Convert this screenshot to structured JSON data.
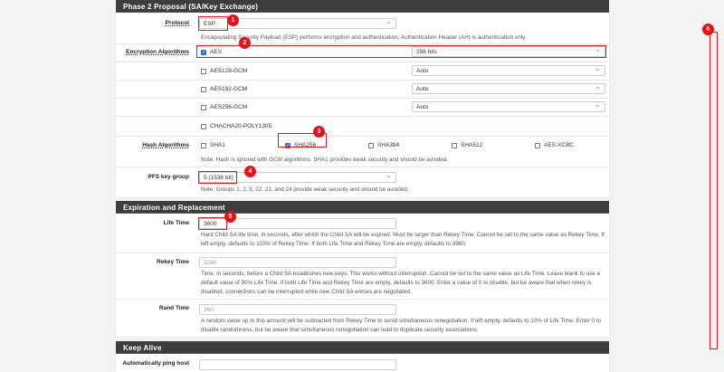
{
  "sections": {
    "phase2": "Phase 2 Proposal (SA/Key Exchange)",
    "expiration": "Expiration and Replacement",
    "keepalive": "Keep Alive"
  },
  "protocol": {
    "label": "Protocol",
    "value": "ESP",
    "note": "Encapsulating Security Payload (ESP) performs encryption and authentication, Authentication Header (AH) is authentication only."
  },
  "encryption": {
    "label": "Encryption Algorithms",
    "items": [
      {
        "name": "AES",
        "checked": true,
        "keylen": "256 bits"
      },
      {
        "name": "AES128-GCM",
        "checked": false,
        "keylen": "Auto"
      },
      {
        "name": "AES192-GCM",
        "checked": false,
        "keylen": "Auto"
      },
      {
        "name": "AES256-GCM",
        "checked": false,
        "keylen": "Auto"
      },
      {
        "name": "CHACHA20-POLY1305",
        "checked": false
      }
    ]
  },
  "hash": {
    "label": "Hash Algorithms",
    "items": [
      {
        "name": "SHA1",
        "checked": false
      },
      {
        "name": "SHA256",
        "checked": true
      },
      {
        "name": "SHA384",
        "checked": false
      },
      {
        "name": "SHA512",
        "checked": false
      },
      {
        "name": "AES-XCBC",
        "checked": false
      }
    ],
    "note": "Note: Hash is ignored with GCM algorithms. SHA1 provides weak security and should be avoided."
  },
  "pfs": {
    "label": "PFS key group",
    "value": "5 (1536 bit)",
    "note": "Note: Groups 1, 2, 5, 22, 23, and 24 provide weak security and should be avoided."
  },
  "lifetime": {
    "label": "Life Time",
    "value": "3600",
    "note": "Hard Child SA life time, in seconds, after which the Child SA will be expired. Must be larger than Rekey Time. Cannot be set to the same value as Rekey Time. If left empty, defaults to 110% of Rekey Time. If both Life Time and Rekey Time are empty, defaults to 3960."
  },
  "rekey": {
    "label": "Rekey Time",
    "placeholder": "3240",
    "note": "Time, in seconds, before a Child SA establishes new keys. This works without interruption. Cannot be set to the same value as Life Time. Leave blank to use a default value of 90% Life Time. If both Life Time and Rekey Time are empty, defaults to 3600. Enter a value of 0 to disable, but be aware that when rekey is disabled, connections can be interrupted while new Child SA entries are negotiated."
  },
  "rand": {
    "label": "Rand Time",
    "placeholder": "360",
    "note": "A random value up to this amount will be subtracted from Rekey Time to avoid simultaneous renegotiation. If left empty, defaults to 10% of Life Time. Enter 0 to disable randomness, but be aware that simultaneous renegotiation can lead to duplicate security associations."
  },
  "ping": {
    "label": "Automatically ping host"
  },
  "annotations": [
    "1",
    "2",
    "3",
    "4",
    "5",
    "6"
  ],
  "colors": {
    "annotation": "#e0141b",
    "header": "#3d3d3d",
    "checkbox": "#2a6fd6"
  }
}
